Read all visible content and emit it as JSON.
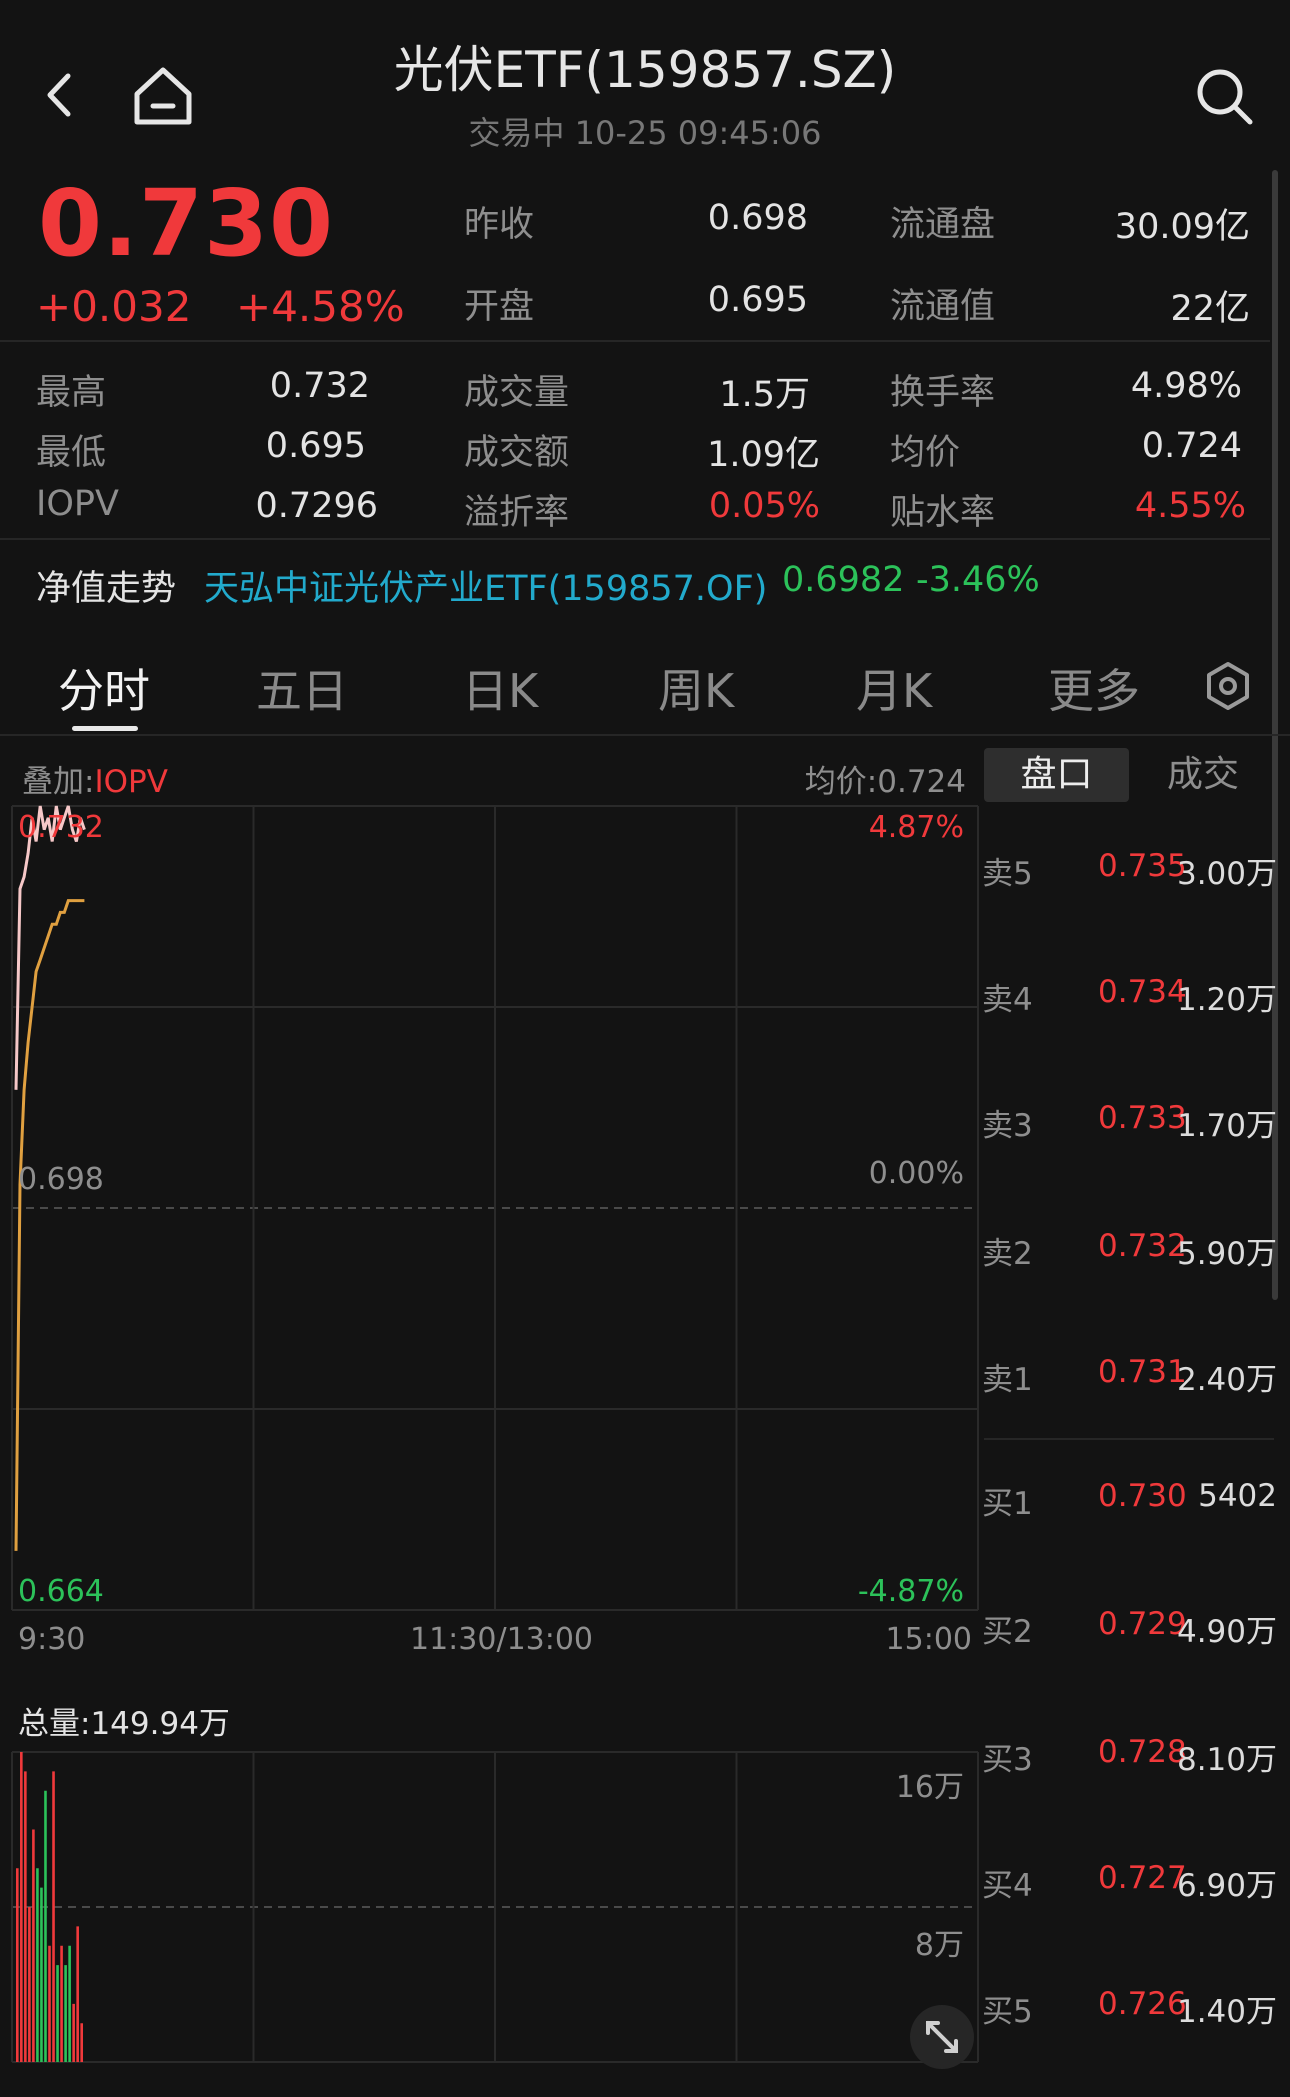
{
  "header": {
    "title": "光伏ETF(159857.SZ)",
    "subtitle": "交易中  10-25 09:45:06"
  },
  "quote": {
    "price": "0.730",
    "change": "+0.032",
    "change_pct": "+4.58%",
    "right_stats": [
      {
        "label": "昨收",
        "value": "0.698"
      },
      {
        "label": "流通盘",
        "value": "30.09亿"
      },
      {
        "label": "开盘",
        "value": "0.695"
      },
      {
        "label": "流通值",
        "value": "22亿"
      }
    ],
    "grid": [
      {
        "label": "最高",
        "value": "0.732"
      },
      {
        "label": "成交量",
        "value": "1.5万"
      },
      {
        "label": "换手率",
        "value": "4.98%"
      },
      {
        "label": "最低",
        "value": "0.695"
      },
      {
        "label": "成交额",
        "value": "1.09亿"
      },
      {
        "label": "均价",
        "value": "0.724"
      },
      {
        "label": "IOPV",
        "value": "0.7296"
      },
      {
        "label": "溢折率",
        "value": "0.05%"
      },
      {
        "label": "贴水率",
        "value": "4.55%"
      }
    ]
  },
  "nav": {
    "label": "净值走势",
    "fund": "天弘中证光伏产业ETF(159857.OF)",
    "value": "0.6982",
    "change": "-3.46%"
  },
  "tabs": [
    "分时",
    "五日",
    "日K",
    "周K",
    "月K",
    "更多"
  ],
  "chart": {
    "overlay_label": "叠加:",
    "overlay_value": "IOPV",
    "avg_label": "均价:0.724",
    "top_price": "0.732",
    "top_pct": "4.87%",
    "mid_price": "0.698",
    "mid_pct": "0.00%",
    "bottom_price": "0.664",
    "bottom_pct": "-4.87%",
    "time_start": "9:30",
    "time_mid": "11:30/13:00",
    "time_end": "15:00",
    "volume_total": "总量:149.94万",
    "vol_tick_high": "16万",
    "vol_tick_mid": "8万"
  },
  "chart_data": {
    "type": "line",
    "title": "",
    "ylim": [
      0.664,
      0.732
    ],
    "prev_close": 0.698,
    "price_series": [
      0.708,
      0.725,
      0.726,
      0.728,
      0.731,
      0.729,
      0.732,
      0.73,
      0.731,
      0.729,
      0.732,
      0.73,
      0.731,
      0.732,
      0.73,
      0.729,
      0.731,
      0.73
    ],
    "avg_series": [
      0.669,
      0.7,
      0.708,
      0.712,
      0.715,
      0.718,
      0.719,
      0.72,
      0.721,
      0.722,
      0.722,
      0.723,
      0.723,
      0.724,
      0.724,
      0.724,
      0.724,
      0.724
    ],
    "volume_series": [
      {
        "v": 10,
        "c": "red"
      },
      {
        "v": 16,
        "c": "red"
      },
      {
        "v": 15,
        "c": "red"
      },
      {
        "v": 8,
        "c": "red"
      },
      {
        "v": 12,
        "c": "red"
      },
      {
        "v": 10,
        "c": "green"
      },
      {
        "v": 9,
        "c": "green"
      },
      {
        "v": 14,
        "c": "green"
      },
      {
        "v": 6,
        "c": "red"
      },
      {
        "v": 15,
        "c": "red"
      },
      {
        "v": 5,
        "c": "green"
      },
      {
        "v": 6,
        "c": "red"
      },
      {
        "v": 5,
        "c": "green"
      },
      {
        "v": 6,
        "c": "green"
      },
      {
        "v": 3,
        "c": "red"
      },
      {
        "v": 7,
        "c": "red"
      },
      {
        "v": 2,
        "c": "red"
      }
    ]
  },
  "orderbook": {
    "tab_pankou": "盘口",
    "tab_deal": "成交",
    "sell": [
      {
        "label": "卖5",
        "price": "0.735",
        "vol": "3.00万"
      },
      {
        "label": "卖4",
        "price": "0.734",
        "vol": "1.20万"
      },
      {
        "label": "卖3",
        "price": "0.733",
        "vol": "1.70万"
      },
      {
        "label": "卖2",
        "price": "0.732",
        "vol": "5.90万"
      },
      {
        "label": "卖1",
        "price": "0.731",
        "vol": "2.40万"
      }
    ],
    "buy": [
      {
        "label": "买1",
        "price": "0.730",
        "vol": "5402"
      },
      {
        "label": "买2",
        "price": "0.729",
        "vol": "4.90万"
      },
      {
        "label": "买3",
        "price": "0.728",
        "vol": "8.10万"
      },
      {
        "label": "买4",
        "price": "0.727",
        "vol": "6.90万"
      },
      {
        "label": "买5",
        "price": "0.726",
        "vol": "1.40万"
      }
    ]
  },
  "colors": {
    "up": "#f0393b",
    "down": "#2cc25a",
    "avg_line": "#e0a040",
    "price_line": "#f6c8c8",
    "accent": "#22aacc"
  }
}
